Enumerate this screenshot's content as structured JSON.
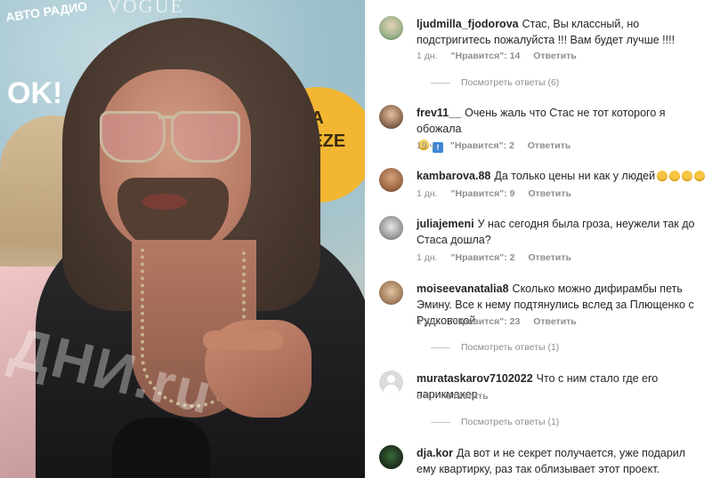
{
  "video": {
    "logos": {
      "radio": "АВТО РАДИО",
      "vogue": "VOGUE",
      "ok": "OK!",
      "c": "C",
      "sponsor": "EA\nEEZE"
    },
    "watermark": "ДНИ.ru"
  },
  "comments": [
    {
      "username": "ljudmilla_fjodorova",
      "text": "Стас, Вы классный, но подстригитесь пожалуйста !!! Вам будет лучше !!!!",
      "time": "1 дн.",
      "likes": "\"Нравится\": 14",
      "reply": "Ответить",
      "view_replies": "Посмотреть ответы (6)"
    },
    {
      "username": "frev11__",
      "text": "Очень жаль что Стас не тот которого я обожала",
      "emoji": [
        "slightly-smiling-face-emoji",
        "exclamation-square-emoji"
      ],
      "time": "19 ч.",
      "likes": "\"Нравится\": 2",
      "reply": "Ответить"
    },
    {
      "username": "kambarova.88",
      "text": "Да только цены ни как у людей",
      "emoji": [
        "laughing-face-emoji",
        "laughing-face-emoji",
        "laughing-face-emoji",
        "laughing-face-emoji"
      ],
      "time": "1 дн.",
      "likes": "\"Нравится\": 9",
      "reply": "Ответить"
    },
    {
      "username": "juliajemeni",
      "text": "У нас сегодня была гроза, неужели так до Стаса дошла?",
      "time": "1 дн.",
      "likes": "\"Нравится\": 2",
      "reply": "Ответить"
    },
    {
      "username": "moiseevanatalia8",
      "text": "Сколько можно дифирамбы петь Эмину. Все к нему подтянулись вслед за Плющенко с Рудковской.",
      "time": "1 дн.",
      "likes": "\"Нравится\": 23",
      "reply": "Ответить",
      "view_replies": "Посмотреть ответы (1)"
    },
    {
      "username": "murataskarov7102022",
      "text": "Что с ним стало где его парикмахер",
      "time": "8 ч.",
      "reply": "Ответить",
      "view_replies": "Посмотреть ответы (1)"
    },
    {
      "username": "dja.kor",
      "text": "Да вот и не секрет получается, уже подарил ему квартирку, раз так облизывает этот проект."
    }
  ]
}
